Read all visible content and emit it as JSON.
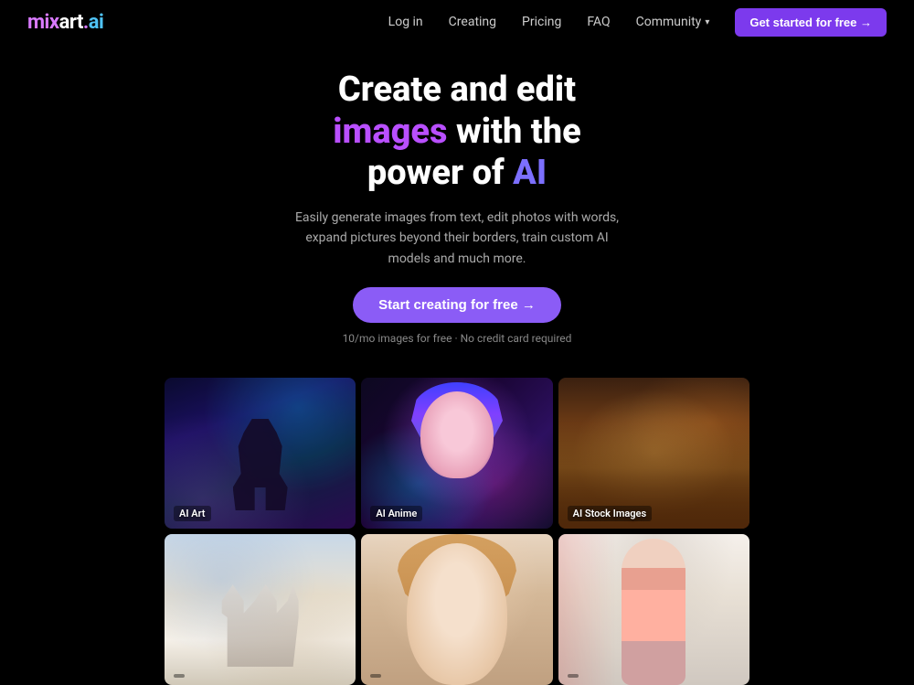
{
  "logo": {
    "mix": "mix",
    "art": "art",
    "dot": ".",
    "ai": "ai"
  },
  "nav": {
    "login": "Log in",
    "creating": "Creating",
    "pricing": "Pricing",
    "faq": "FAQ",
    "community": "Community",
    "cta": "Get started for free →"
  },
  "hero": {
    "line1": "Create and edit",
    "line2_start": "",
    "highlight1": "images",
    "line2_end": " with the",
    "line3_start": "power of ",
    "highlight2": "AI",
    "description": "Easily generate images from text, edit photos with words, expand pictures beyond their borders, train custom AI models and much more.",
    "cta_button": "Start creating for free →",
    "sub_note": "10/mo images for free · No credit card required"
  },
  "grid": {
    "items": [
      {
        "label": "AI Art"
      },
      {
        "label": "AI Anime"
      },
      {
        "label": "AI Stock Images"
      },
      {
        "label": ""
      },
      {
        "label": ""
      },
      {
        "label": ""
      }
    ]
  }
}
